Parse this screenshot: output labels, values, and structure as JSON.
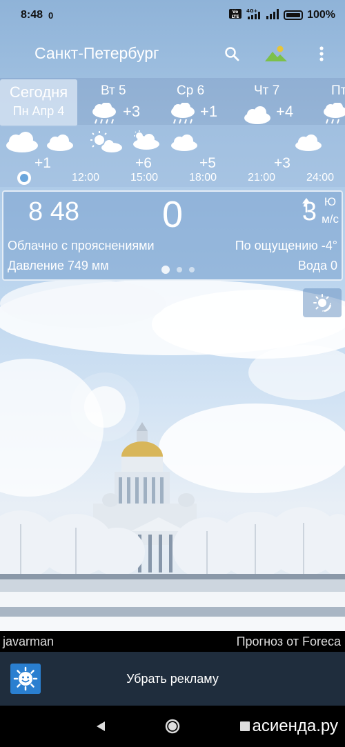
{
  "status": {
    "time": "8:48",
    "extra": "0",
    "battery": "100%",
    "network": "4G+"
  },
  "app": {
    "city": "Санкт-Петербург",
    "icons": [
      "search-icon",
      "landscape-icon",
      "more-vert-icon"
    ]
  },
  "today": {
    "line1": "Сегодня",
    "line2": "Пн Апр 4"
  },
  "days": [
    {
      "name": "Вт 5",
      "temp": "+3",
      "icon": "rain-cloud-icon"
    },
    {
      "name": "Ср 6",
      "temp": "+1",
      "icon": "rain-cloud-icon"
    },
    {
      "name": "Чт 7",
      "temp": "+4",
      "icon": "cloud-icon"
    },
    {
      "name": "Пт",
      "temp": "",
      "icon": "rain-cloud-icon"
    }
  ],
  "hours": [
    {
      "temp": "+1",
      "time": ""
    },
    {
      "temp": "",
      "time": "12:00"
    },
    {
      "temp": "+6",
      "time": "15:00"
    },
    {
      "temp": "+5",
      "time": "18:00"
    },
    {
      "temp": "+3",
      "time": "21:00"
    },
    {
      "temp": "",
      "time": "24:00"
    }
  ],
  "current": {
    "time": "8 48",
    "temp": "0",
    "wind_speed": "3",
    "wind_dir": "Ю",
    "wind_unit": "м/с",
    "condition": "Облачно с прояснениями",
    "feels_like": "По ощущению -4°",
    "pressure": "Давление 749 мм",
    "water": "Вода 0",
    "page_count": 3,
    "active_page": 1
  },
  "credits": {
    "photo": "javarman",
    "source": "Прогноз от Foreca"
  },
  "ad": {
    "label": "Убрать рекламу"
  },
  "watermark": "асиенда.ру",
  "colors": {
    "ad_bar": "#1f2d3d",
    "ad_icon": "#2a7fd0"
  }
}
